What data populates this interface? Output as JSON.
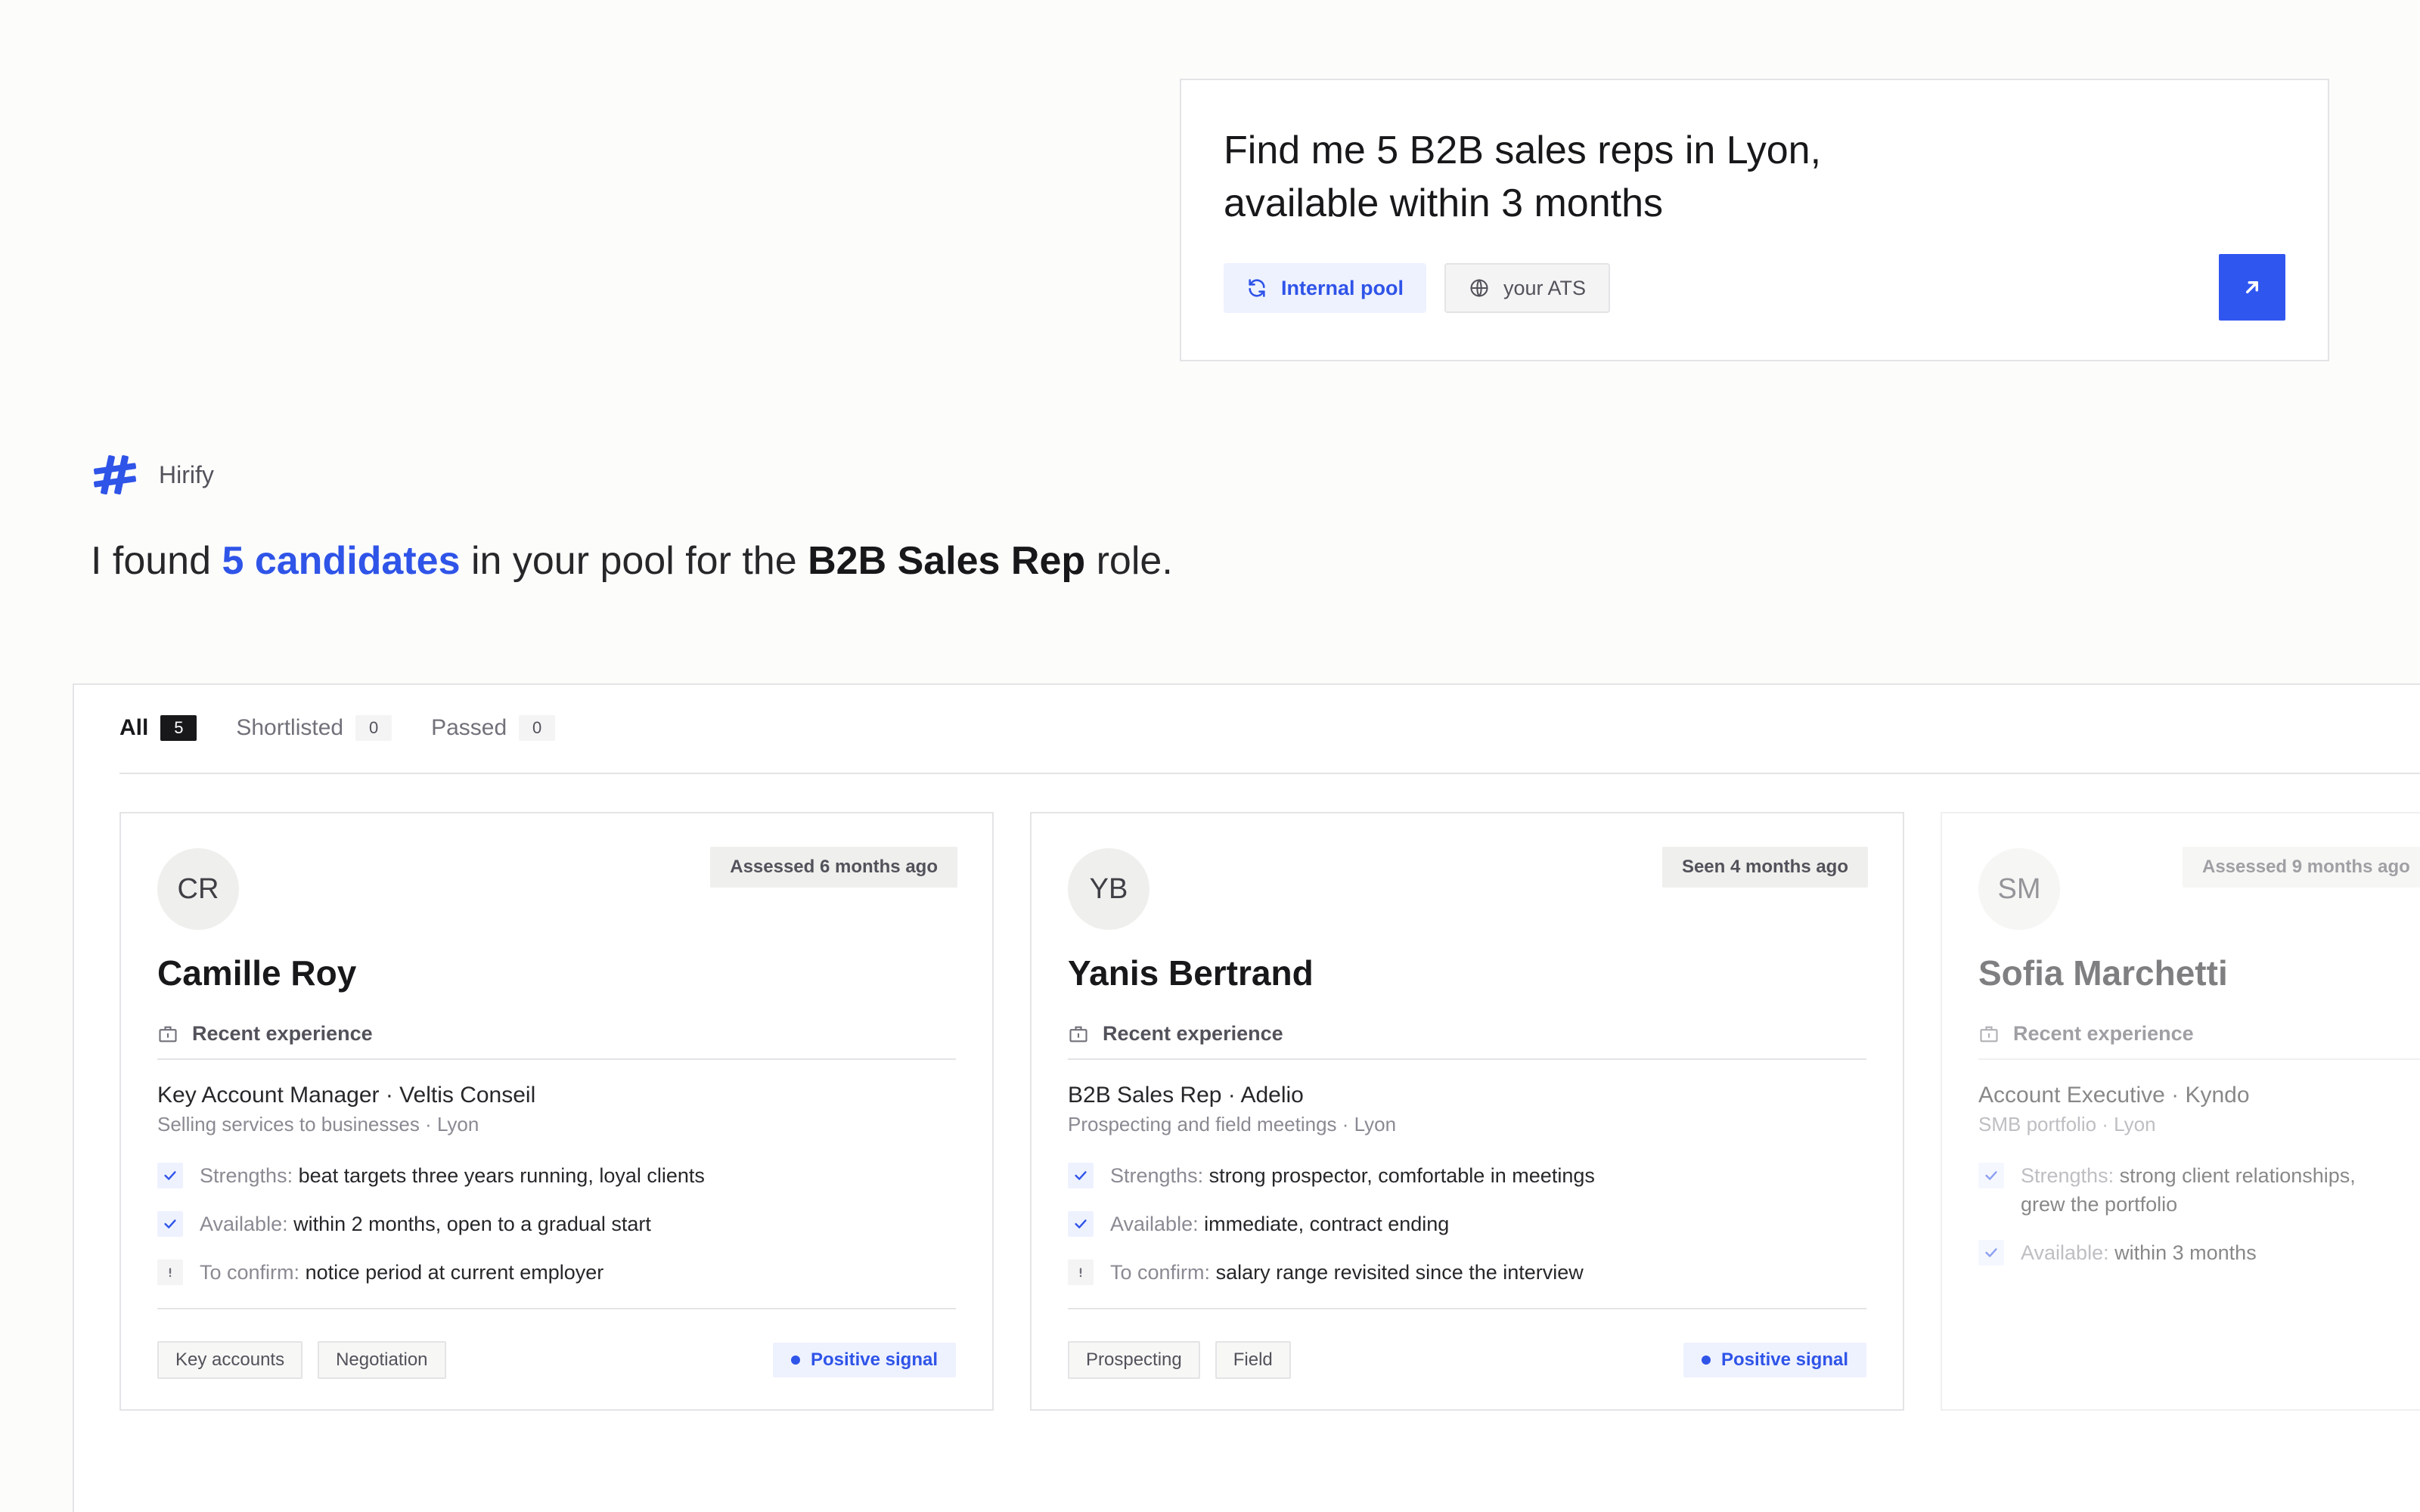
{
  "prompt": {
    "text": "Find me 5 B2B sales reps in Lyon, available within 3 months",
    "sources": [
      {
        "label": "Internal pool",
        "icon": "refresh-icon",
        "active": true
      },
      {
        "label": "your ATS",
        "icon": "globe-icon",
        "active": false
      }
    ],
    "send_icon": "arrow-up-right-icon"
  },
  "assistant": {
    "name": "Hirify",
    "response": {
      "pre": "I found ",
      "count": "5 candidates",
      "mid": " in your pool for the ",
      "role": "B2B Sales Rep",
      "post": " role."
    }
  },
  "tabs": [
    {
      "label": "All",
      "count": "5",
      "active": true
    },
    {
      "label": "Shortlisted",
      "count": "0",
      "active": false
    },
    {
      "label": "Passed",
      "count": "0",
      "active": false
    }
  ],
  "candidates": [
    {
      "initials": "CR",
      "status": "Assessed 6 months ago",
      "name": "Camille Roy",
      "section": "Recent experience",
      "role": "Key Account Manager · Veltis Conseil",
      "role_sub": "Selling services to businesses · Lyon",
      "facts": [
        {
          "type": "check",
          "label": "Strengths:",
          "value": "beat targets three years running, loyal clients"
        },
        {
          "type": "check",
          "label": "Available:",
          "value": "within 2 months, open to a gradual start"
        },
        {
          "type": "warn",
          "label": "To confirm:",
          "value": "notice period at current employer"
        }
      ],
      "tags": [
        "Key accounts",
        "Negotiation"
      ],
      "signal": "Positive signal"
    },
    {
      "initials": "YB",
      "status": "Seen 4 months ago",
      "name": "Yanis Bertrand",
      "section": "Recent experience",
      "role": "B2B Sales Rep · Adelio",
      "role_sub": "Prospecting and field meetings · Lyon",
      "facts": [
        {
          "type": "check",
          "label": "Strengths:",
          "value": "strong prospector, comfortable in meetings"
        },
        {
          "type": "check",
          "label": "Available:",
          "value": "immediate, contract ending"
        },
        {
          "type": "warn",
          "label": "To confirm:",
          "value": "salary range revisited since the interview"
        }
      ],
      "tags": [
        "Prospecting",
        "Field"
      ],
      "signal": "Positive signal"
    },
    {
      "initials": "SM",
      "status": "Assessed 9 months ago",
      "name": "Sofia Marchetti",
      "section": "Recent experience",
      "role": "Account Executive · Kyndo",
      "role_sub": "SMB portfolio · Lyon",
      "facts": [
        {
          "type": "check",
          "label": "Strengths:",
          "value": "strong client relationships, grew the portfolio"
        },
        {
          "type": "check",
          "label": "Available:",
          "value": "within 3 months"
        }
      ],
      "tags": [],
      "signal": ""
    }
  ],
  "colors": {
    "accent": "#2f54e8",
    "send_button": "#3056f0",
    "text": "#18181b",
    "muted": "#8a8a93",
    "border": "#e4e4e7"
  }
}
